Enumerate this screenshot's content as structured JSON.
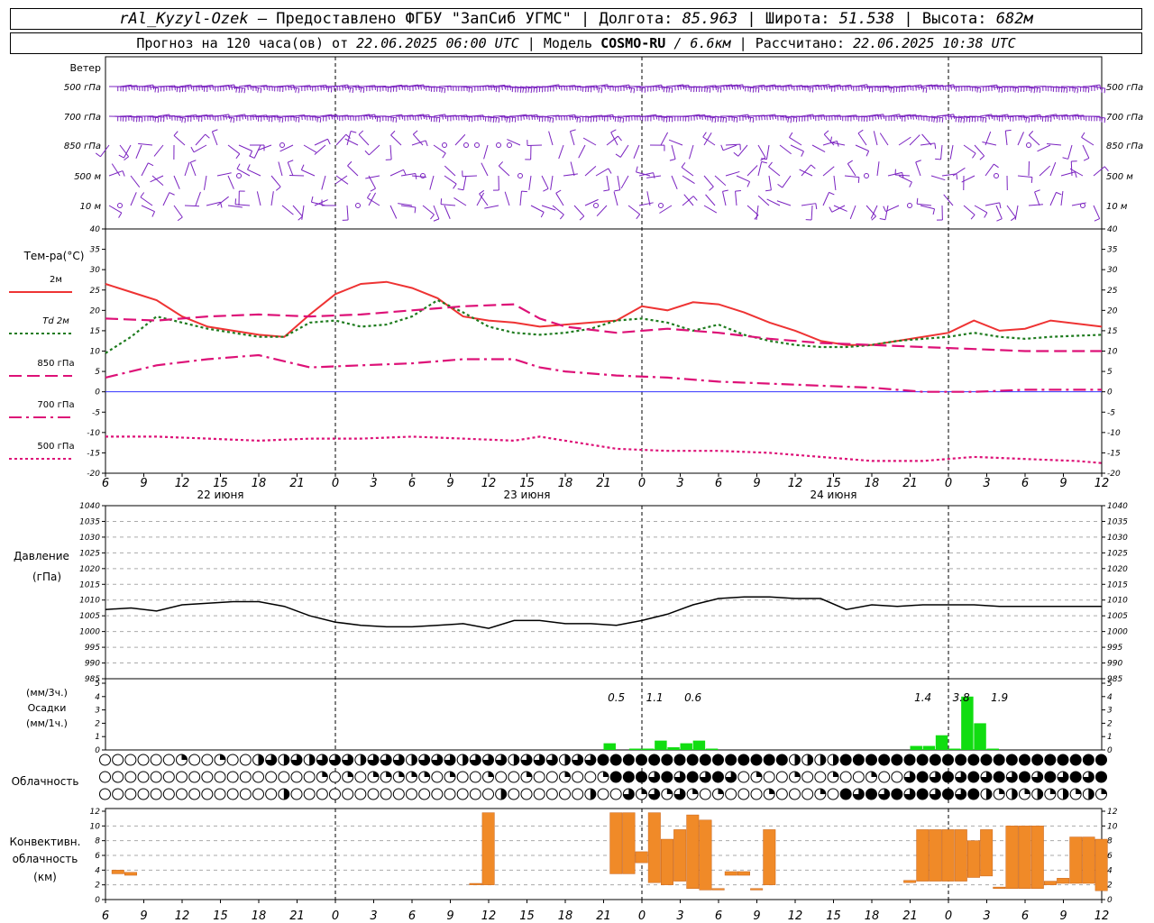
{
  "header": {
    "station": "rAl_Kyzyl-Ozek",
    "provider": "Предоставлено ФГБУ \"ЗапСиб УГМС\"",
    "lon_label": "Долгота:",
    "lon_value": "85.963",
    "lat_label": "Широта:",
    "lat_value": "51.538",
    "alt_label": "Высота:",
    "alt_value": "682м",
    "forecast_label": "Прогноз на 120 часа(ов) от",
    "forecast_time": "22.06.2025 06:00 UTC",
    "model_label": "Модель",
    "model_name": "COSMO-RU",
    "model_res": "/ 6.6км",
    "calc_label": "Рассчитано:",
    "calc_time": "22.06.2025 10:38 UTC"
  },
  "time_axis": {
    "hour_ticks": [
      "6",
      "9",
      "12",
      "15",
      "18",
      "21",
      "0",
      "3",
      "6",
      "9",
      "12",
      "15",
      "18",
      "21",
      "0",
      "3",
      "6",
      "9",
      "12",
      "15",
      "18",
      "21",
      "0",
      "3",
      "6",
      "9",
      "12"
    ],
    "day_labels": [
      {
        "label": "22 июня",
        "index": 3
      },
      {
        "label": "23 июня",
        "index": 11
      },
      {
        "label": "24 июня",
        "index": 19
      }
    ],
    "midnight_indices": [
      6,
      14,
      22
    ]
  },
  "panels": {
    "wind": {
      "title": "Ветер",
      "levels": [
        "500 гПа",
        "700 гПа",
        "850 гПа",
        "500 м",
        "10  м"
      ],
      "color": "#7a22c0"
    },
    "temperature": {
      "title": "Тем-ра(°С)",
      "yticks": [
        40,
        35,
        30,
        25,
        20,
        15,
        10,
        5,
        0,
        -5,
        -10,
        -15,
        -20
      ],
      "legend": [
        {
          "label": "2м",
          "color": "#ee3333",
          "style": "solid"
        },
        {
          "label": "Td  2м",
          "color": "#1e7b1e",
          "style": "dotted"
        },
        {
          "label": "850 гПа",
          "color": "#dd1177",
          "style": "dashed"
        },
        {
          "label": "700 гПа",
          "color": "#dd1177",
          "style": "dashdot"
        },
        {
          "label": "500 гПа",
          "color": "#dd1177",
          "style": "dotted"
        }
      ]
    },
    "pressure": {
      "title": "Давление",
      "units": "(гПа)",
      "yticks": [
        1040,
        1035,
        1030,
        1025,
        1020,
        1015,
        1010,
        1005,
        1000,
        995,
        990,
        985
      ]
    },
    "precip": {
      "title_units1": "(мм/3ч.)",
      "title": "Осадки",
      "title_units2": "(мм/1ч.)",
      "yticks": [
        5,
        4,
        3,
        2,
        1,
        0
      ],
      "totals": [
        {
          "label": "0.5",
          "hour": 40
        },
        {
          "label": "1.1",
          "hour": 43
        },
        {
          "label": "0.6",
          "hour": 46
        },
        {
          "label": "1.4",
          "hour": 64
        },
        {
          "label": "3.8",
          "hour": 67
        },
        {
          "label": "1.9",
          "hour": 70
        }
      ]
    },
    "cloud": {
      "title": "Облачность"
    },
    "convective": {
      "title1": "Конвективн.",
      "title2": "облачность",
      "title3": "(км)",
      "yticks": [
        12,
        10,
        8,
        6,
        4,
        2,
        0
      ]
    }
  },
  "chart_data": [
    {
      "type": "line",
      "title": "Тем-ра(°С)",
      "x_unit": "hours from 22.06.2025 06:00 UTC",
      "ylim": [
        -20,
        40
      ],
      "series": [
        {
          "name": "2м",
          "x": [
            0,
            2,
            4,
            6,
            8,
            10,
            12,
            14,
            16,
            18,
            20,
            22,
            24,
            26,
            28,
            30,
            32,
            34,
            36,
            38,
            40,
            42,
            44,
            46,
            48,
            50,
            52,
            54,
            56,
            58,
            60,
            62,
            64,
            66,
            68,
            70,
            72,
            74,
            78
          ],
          "values": [
            26.5,
            24.5,
            22.5,
            18.5,
            16,
            15,
            14,
            13.5,
            19,
            24,
            26.5,
            27,
            25.5,
            23,
            18.5,
            17.5,
            17,
            16,
            16.5,
            17,
            17.5,
            21,
            20,
            22,
            21.5,
            19.5,
            17,
            15,
            12.5,
            11.5,
            11.5,
            12.5,
            13.5,
            14.5,
            17.5,
            15,
            15.5,
            17.5,
            16
          ]
        },
        {
          "name": "Td  2м",
          "x": [
            0,
            2,
            4,
            6,
            8,
            10,
            12,
            14,
            16,
            18,
            20,
            22,
            24,
            26,
            28,
            30,
            32,
            34,
            36,
            38,
            40,
            42,
            44,
            46,
            48,
            50,
            52,
            54,
            56,
            58,
            60,
            62,
            64,
            66,
            68,
            70,
            72,
            74,
            78
          ],
          "values": [
            9.5,
            13.5,
            18.5,
            17,
            15.5,
            14.5,
            13.5,
            13.5,
            17,
            17.5,
            16,
            16.5,
            18.5,
            22.5,
            19.5,
            16,
            14.5,
            14,
            14.5,
            15.5,
            17.5,
            18,
            17,
            15,
            16.5,
            14,
            12.5,
            11.5,
            11,
            11,
            11.5,
            12.5,
            13,
            13.5,
            14.5,
            13.5,
            13,
            13.5,
            14
          ]
        },
        {
          "name": "850 гПа",
          "x": [
            0,
            4,
            8,
            12,
            16,
            20,
            24,
            28,
            32,
            34,
            36,
            40,
            44,
            48,
            52,
            56,
            60,
            64,
            68,
            72,
            76,
            78
          ],
          "values": [
            18,
            17.5,
            18.5,
            19,
            18.5,
            19,
            20,
            21,
            21.5,
            18,
            16,
            14.5,
            15.5,
            14.5,
            13,
            12,
            11.5,
            11,
            10.5,
            10,
            10,
            10
          ]
        },
        {
          "name": "700 гПа",
          "x": [
            0,
            4,
            8,
            12,
            16,
            20,
            24,
            28,
            32,
            34,
            36,
            40,
            44,
            48,
            52,
            56,
            60,
            64,
            68,
            72,
            76,
            78
          ],
          "values": [
            3.5,
            6.5,
            8,
            9,
            6,
            6.5,
            7,
            8,
            8,
            6,
            5,
            4,
            3.5,
            2.5,
            2,
            1.5,
            1,
            0,
            0,
            0.5,
            0.5,
            0.5
          ]
        },
        {
          "name": "500 гПа",
          "x": [
            0,
            4,
            8,
            12,
            16,
            20,
            24,
            28,
            32,
            34,
            36,
            40,
            44,
            48,
            52,
            56,
            60,
            64,
            68,
            72,
            76,
            78
          ],
          "values": [
            -11,
            -11,
            -11.5,
            -12,
            -11.5,
            -11.5,
            -11,
            -11.5,
            -12,
            -11,
            -12,
            -14,
            -14.5,
            -14.5,
            -15,
            -16,
            -17,
            -17,
            -16,
            -16.5,
            -17,
            -17.5
          ]
        }
      ]
    },
    {
      "type": "line",
      "title": "Давление",
      "x_unit": "hours from 22.06.2025 06:00 UTC",
      "ylim": [
        985,
        1040
      ],
      "series": [
        {
          "name": "Давление",
          "x": [
            0,
            2,
            4,
            6,
            8,
            10,
            12,
            14,
            16,
            18,
            20,
            22,
            24,
            26,
            28,
            30,
            32,
            34,
            36,
            38,
            40,
            42,
            44,
            46,
            48,
            50,
            52,
            54,
            56,
            58,
            60,
            62,
            64,
            66,
            68,
            70,
            72,
            74,
            76,
            78
          ],
          "values": [
            1007,
            1007.5,
            1006.5,
            1008.5,
            1009,
            1009.5,
            1009.5,
            1008,
            1005,
            1003,
            1002,
            1001.5,
            1001.5,
            1002,
            1002.5,
            1001,
            1003.5,
            1003.5,
            1002.5,
            1002.5,
            1002,
            1003.5,
            1005.5,
            1008.5,
            1010.5,
            1011,
            1011,
            1010.5,
            1010.5,
            1007,
            1008.5,
            1008,
            1008.5,
            1008.5,
            1008.5,
            1008,
            1008,
            1008,
            1008,
            1008
          ]
        }
      ]
    },
    {
      "type": "bar",
      "title": "Осадки",
      "x_unit": "hours from 22.06.2025 06:00 UTC",
      "ylim": [
        0,
        5
      ],
      "series": [
        {
          "name": "мм/1ч.",
          "x": [
            39,
            41,
            42,
            43,
            44,
            45,
            46,
            47,
            63,
            64,
            65,
            66,
            67,
            68,
            69
          ],
          "values": [
            0.5,
            0.1,
            0.1,
            0.7,
            0.2,
            0.5,
            0.7,
            0.1,
            0.3,
            0.3,
            1.1,
            0.1,
            4.0,
            2.0,
            0.1
          ]
        }
      ]
    },
    {
      "type": "bar",
      "title": "Конвективн. облачность",
      "x_unit": "hours from 22.06.2025 06:00 UTC",
      "ylim": [
        0,
        12
      ],
      "series": [
        {
          "name": "convective cloud layers (bottom,top km)",
          "x": [
            1,
            2,
            29,
            30,
            40,
            41,
            42,
            43,
            44,
            45,
            46,
            47,
            48,
            49,
            50,
            51,
            52,
            53,
            54,
            63,
            64,
            65,
            66,
            67,
            68,
            69,
            70,
            71,
            72,
            73,
            74,
            75,
            76,
            77,
            78
          ],
          "values": [
            [
              3.5,
              4
            ],
            [
              3.3,
              3.7
            ],
            [
              2,
              2.2
            ],
            [
              2,
              11.8
            ],
            [
              3.5,
              11.8
            ],
            [
              3.5,
              11.8
            ],
            [
              5,
              6.5
            ],
            [
              2.3,
              11.8
            ],
            [
              2,
              8.2
            ],
            [
              2.5,
              9.5
            ],
            [
              1.5,
              11.5
            ],
            [
              1.3,
              10.8
            ],
            [
              1.3,
              1.5
            ],
            [
              3.3,
              3.8
            ],
            [
              3.3,
              3.8
            ],
            [
              1.3,
              1.5
            ],
            [
              2,
              9.5
            ],
            [
              0,
              0
            ],
            [
              0,
              0
            ],
            [
              2.3,
              2.6
            ],
            [
              2.5,
              9.5
            ],
            [
              2.5,
              9.5
            ],
            [
              2.5,
              9.5
            ],
            [
              2.5,
              9.5
            ],
            [
              3,
              8
            ],
            [
              3.2,
              9.5
            ],
            [
              1.5,
              1.7
            ],
            [
              1.5,
              10
            ],
            [
              1.5,
              10
            ],
            [
              1.5,
              10
            ],
            [
              2,
              2.5
            ],
            [
              2.2,
              2.9
            ],
            [
              2.2,
              8.5
            ],
            [
              2.2,
              8.5
            ],
            [
              1.2,
              8.2
            ]
          ]
        }
      ]
    }
  ]
}
